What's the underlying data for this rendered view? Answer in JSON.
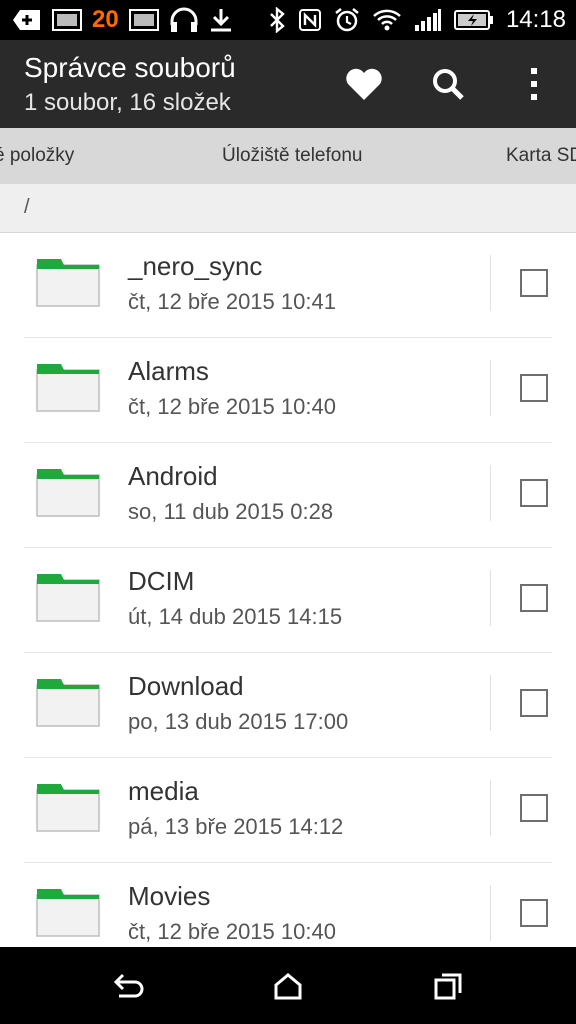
{
  "status_bar": {
    "notification_count": "20",
    "time": "14:18"
  },
  "app_bar": {
    "title": "Správce souborů",
    "subtitle": "1 soubor, 16 složek"
  },
  "tabs": {
    "left": "é položky",
    "center": "Úložiště telefonu",
    "right": "Karta SD"
  },
  "path": "/",
  "files": [
    {
      "name": "_nero_sync",
      "date": "čt, 12 bře 2015 10:41"
    },
    {
      "name": "Alarms",
      "date": "čt, 12 bře 2015 10:40"
    },
    {
      "name": "Android",
      "date": "so, 11 dub 2015 0:28"
    },
    {
      "name": "DCIM",
      "date": "út, 14 dub 2015 14:15"
    },
    {
      "name": "Download",
      "date": "po, 13 dub 2015 17:00"
    },
    {
      "name": "media",
      "date": "pá, 13 bře 2015 14:12"
    },
    {
      "name": "Movies",
      "date": "čt, 12 bře 2015 10:40"
    }
  ],
  "icons": {
    "favorite": "heart-icon",
    "search": "search-icon",
    "menu": "overflow-menu-icon",
    "folder": "folder-icon",
    "back": "back-icon",
    "home": "home-icon",
    "recents": "recents-icon"
  },
  "colors": {
    "status_bar": "#000000",
    "action_bar": "#2a2a2a",
    "tab_bar": "#d8d8d8",
    "folder_accent": "#1fa83b",
    "notification_number": "#ff6a00"
  }
}
